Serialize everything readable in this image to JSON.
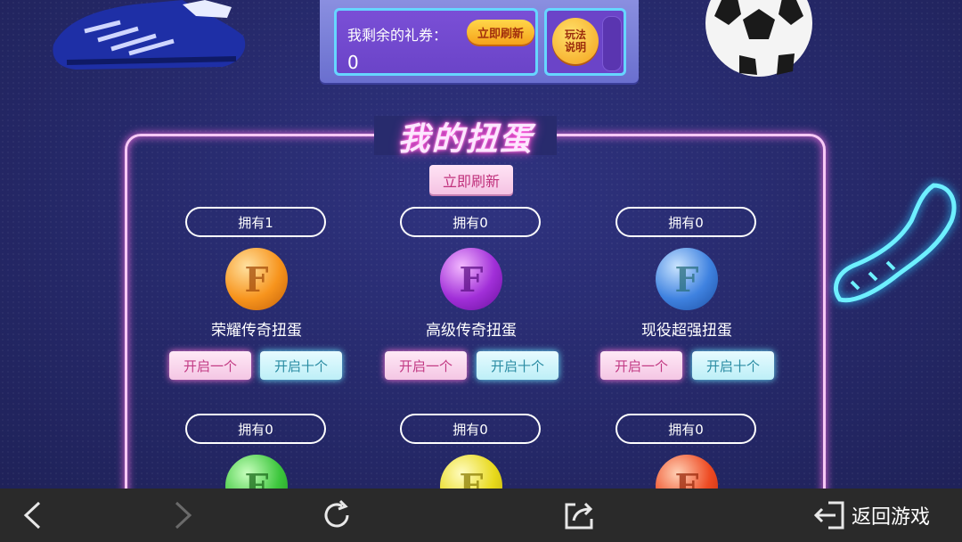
{
  "coupon": {
    "label": "我剩余的礼券：",
    "count": "0",
    "refresh_label": "立即刷新",
    "rules_label": "玩法\n说明"
  },
  "panel": {
    "title": "我的扭蛋",
    "refresh_label": "立即刷新"
  },
  "eggs": [
    {
      "owned": "拥有1",
      "name": "荣耀传奇扭蛋",
      "letter": "F",
      "color": "#f7941d",
      "open_one": "开启一个",
      "open_ten": "开启十个"
    },
    {
      "owned": "拥有0",
      "name": "高级传奇扭蛋",
      "letter": "F",
      "color": "#a12fd8",
      "open_one": "开启一个",
      "open_ten": "开启十个"
    },
    {
      "owned": "拥有0",
      "name": "现役超强扭蛋",
      "letter": "F",
      "color": "#3f82e0",
      "open_one": "开启一个",
      "open_ten": "开启十个"
    },
    {
      "owned": "拥有0",
      "letter": "F",
      "color": "#3cc63c"
    },
    {
      "owned": "拥有0",
      "letter": "F",
      "color": "#e8d91c"
    },
    {
      "owned": "拥有0",
      "letter": "F",
      "color": "#ee4a22"
    }
  ],
  "browser_bar": {
    "back_to_game": "返回游戏"
  },
  "colors": {
    "background": "#262a6c",
    "neon_pink": "#f7c9f5",
    "neon_blue": "#66d6ff",
    "navbar": "#2a2a2a"
  },
  "icons": [
    "back-arrow-icon",
    "forward-arrow-icon",
    "refresh-icon",
    "share-icon",
    "exit-icon"
  ]
}
